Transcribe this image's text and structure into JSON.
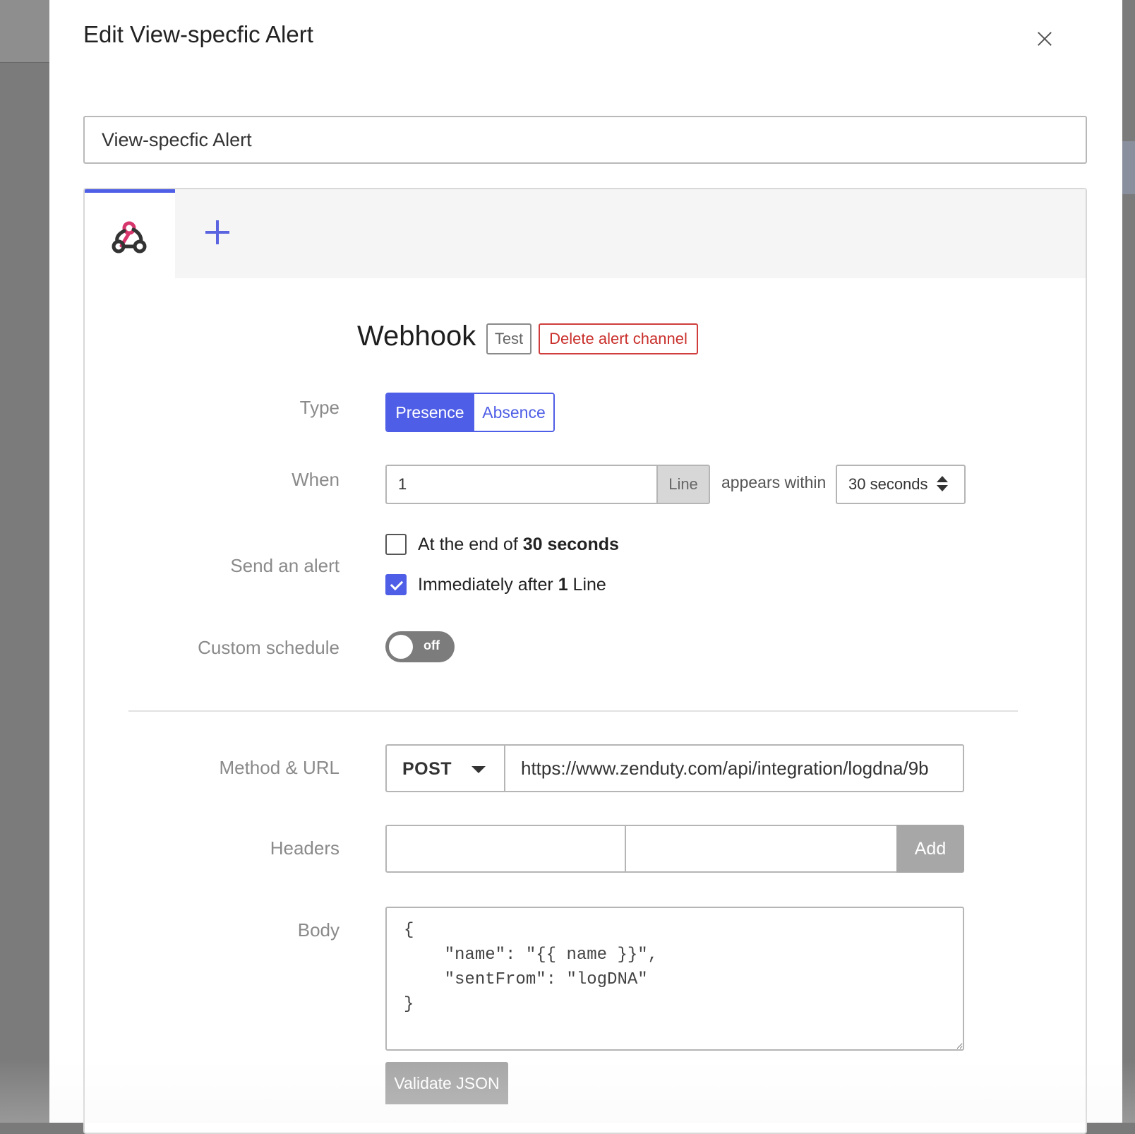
{
  "modal": {
    "title": "Edit View-specfic Alert",
    "alert_name": "View-specfic Alert"
  },
  "tabs": [
    {
      "icon": "webhook-icon",
      "selected": true
    },
    {
      "icon": "plus-icon",
      "selected": false
    }
  ],
  "channel": {
    "title": "Webhook",
    "test_label": "Test",
    "delete_label": "Delete alert channel"
  },
  "form": {
    "type_label": "Type",
    "type_options": [
      "Presence",
      "Absence"
    ],
    "type_selected": "Presence",
    "when_label": "When",
    "when_value": "1",
    "when_unit": "Line",
    "appears_within": "appears within",
    "duration_value": "30 seconds",
    "send_alert_label": "Send an alert",
    "end_of_prefix": "At the end of ",
    "end_of_bold": "30 seconds",
    "end_of_checked": false,
    "immediately_prefix": "Immediately after ",
    "immediately_bold": "1",
    "immediately_suffix": " Line",
    "immediately_checked": true,
    "custom_schedule_label": "Custom schedule",
    "custom_schedule_state": "off",
    "method_url_label": "Method & URL",
    "method": "POST",
    "url": "https://www.zenduty.com/api/integration/logdna/9b",
    "headers_label": "Headers",
    "header_key": "",
    "header_value": "",
    "add_label": "Add",
    "body_label": "Body",
    "body_value": "{\n    \"name\": \"{{ name }}\",\n    \"sentFrom\": \"logDNA\"\n}",
    "validate_label": "Validate JSON"
  },
  "colors": {
    "accent": "#4f5ee6",
    "danger": "#c9302c",
    "muted_button": "#a7a7a7",
    "toggle_off": "#7c7c7c"
  }
}
